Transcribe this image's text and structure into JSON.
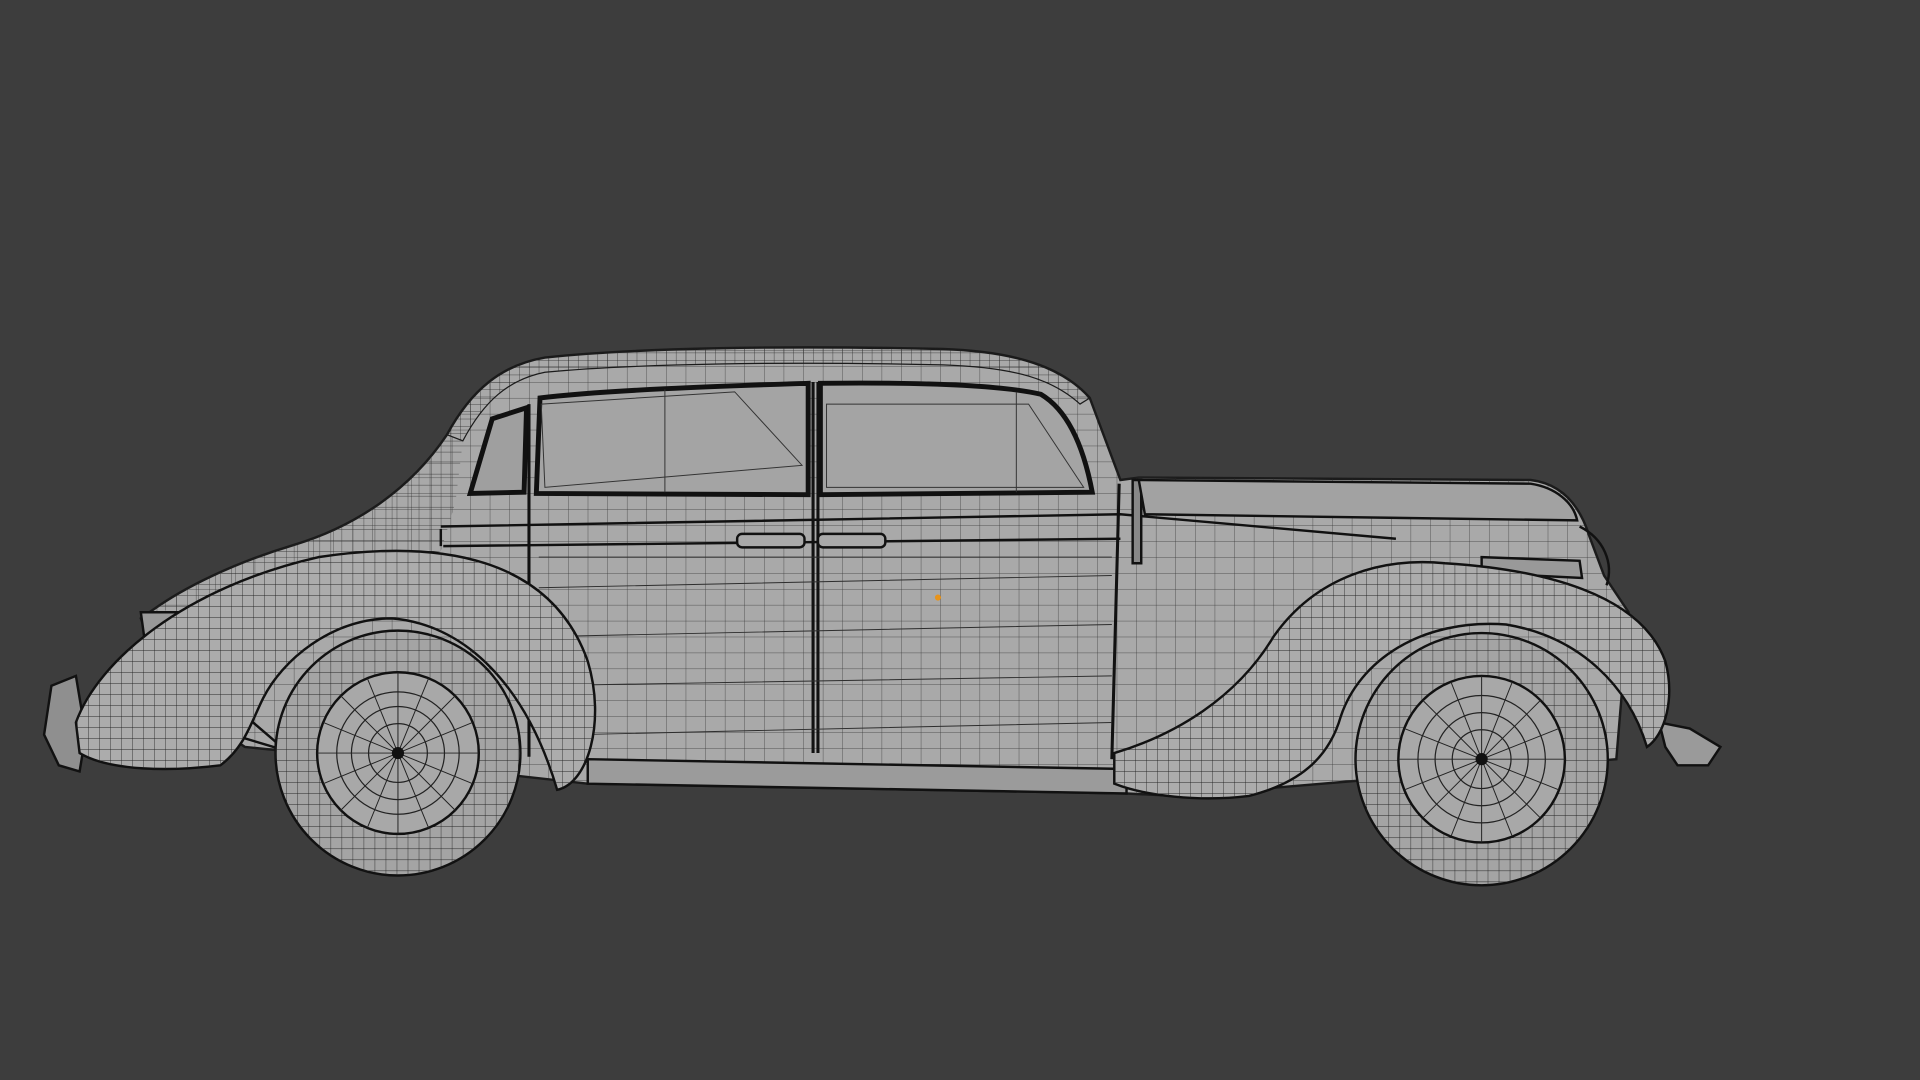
{
  "viewport": {
    "background": "#3d3d3d",
    "mode": "wireframe-over-solid",
    "object": "vintage-sedan-side-view",
    "colors": {
      "body_fill": "#a9a9a9",
      "tire_fill": "#a4a4a4",
      "wire": "#1b1b1b",
      "origin_dot": "#e8941b"
    }
  }
}
